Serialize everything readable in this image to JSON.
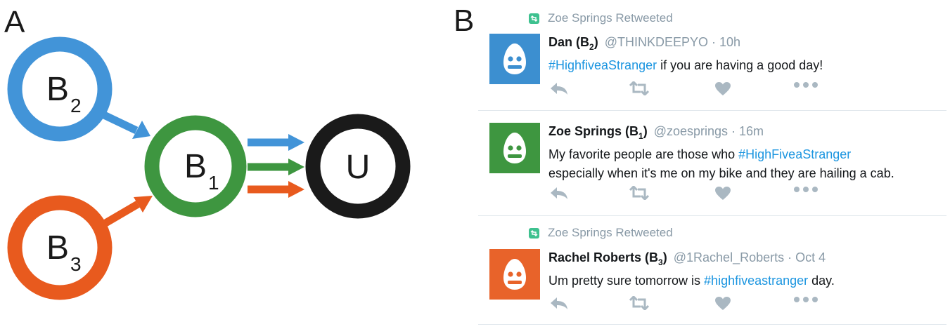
{
  "panels": {
    "a_label": "A",
    "b_label": "B"
  },
  "diagram": {
    "nodes": [
      {
        "id": "b2",
        "label": "B",
        "sub": "2",
        "color": "#4294d8"
      },
      {
        "id": "b3",
        "label": "B",
        "sub": "3",
        "color": "#e85a1e"
      },
      {
        "id": "b1",
        "label": "B",
        "sub": "1",
        "color": "#3e9640"
      },
      {
        "id": "u",
        "label": "U",
        "sub": "",
        "color": "#1a1a1a"
      }
    ],
    "edges": [
      {
        "from": "b2",
        "to": "b1",
        "color": "#4294d8"
      },
      {
        "from": "b3",
        "to": "b1",
        "color": "#e85a1e"
      },
      {
        "from": "b1",
        "to": "u",
        "color": "#4294d8"
      },
      {
        "from": "b1",
        "to": "u",
        "color": "#3e9640"
      },
      {
        "from": "b1",
        "to": "u",
        "color": "#e85a1e"
      }
    ]
  },
  "feed": {
    "retweet_label_1": "Zoe Springs Retweeted",
    "retweet_label_2": "Zoe Springs Retweeted",
    "tweets": [
      {
        "name": "Dan (B",
        "name_sub": "2",
        "name_end": ")",
        "handle": "@THINKDEEPYO · 10h",
        "hashtag": "#HighfiveaStranger",
        "text": " if you are having a good day!",
        "avatar_color": "#3c8fd0"
      },
      {
        "name": "Zoe Springs (B",
        "name_sub": "1",
        "name_end": ")",
        "handle": "@zoesprings · 16m",
        "text_before": "My favorite people are those who ",
        "hashtag": "#HighFiveaStranger",
        "text_line2": "especially when it's me on my bike and they are hailing a cab.",
        "avatar_color": "#3e9640"
      },
      {
        "name": "Rachel Roberts (B",
        "name_sub": "3",
        "name_end": ")",
        "handle": "@1Rachel_Roberts · Oct 4",
        "text_before": "Um pretty sure tomorrow is ",
        "hashtag": "#highfiveastranger",
        "text_after": " day.",
        "avatar_color": "#e8632a"
      }
    ],
    "icons": [
      "reply-icon",
      "retweet-icon",
      "like-icon",
      "more-icon"
    ]
  }
}
